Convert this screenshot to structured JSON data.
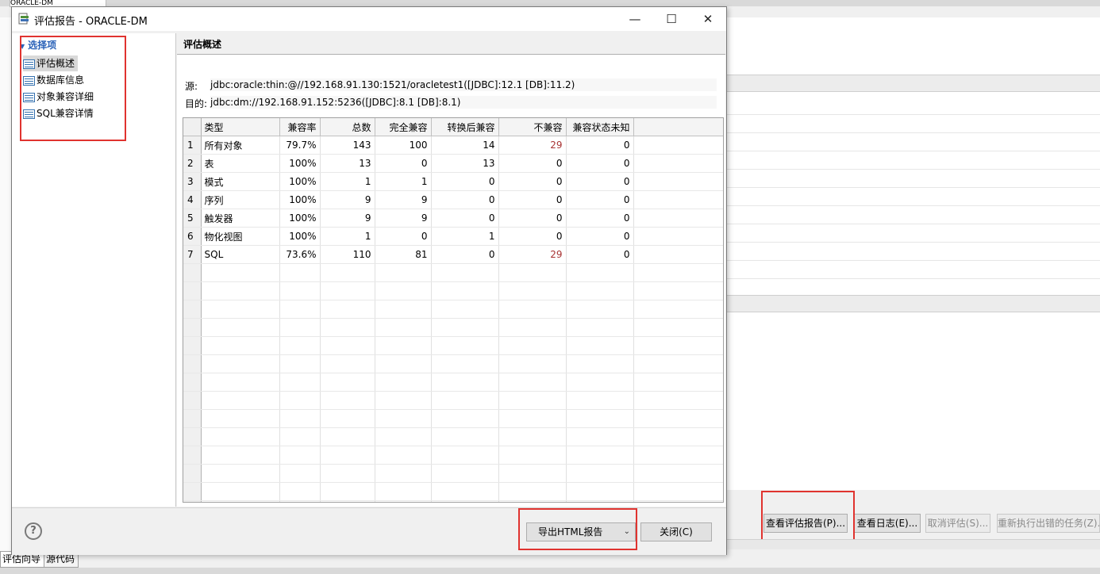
{
  "dialog": {
    "title": "评估报告 - ORACLE-DM",
    "controls": {
      "minimize": "—",
      "maximize": "☐",
      "close": "✕"
    }
  },
  "tree": {
    "root_label": "选择项",
    "items": [
      {
        "label": "评估概述",
        "selected": true
      },
      {
        "label": "数据库信息"
      },
      {
        "label": "对象兼容详细"
      },
      {
        "label": "SQL兼容详情"
      }
    ]
  },
  "overview": {
    "title": "评估概述",
    "source_label": "源:",
    "source_value": "jdbc:oracle:thin:@//192.168.91.130:1521/oracletest1([JDBC]:12.1 [DB]:11.2)",
    "target_label": "目的:",
    "target_value": "jdbc:dm://192.168.91.152:5236([JDBC]:8.1 [DB]:8.1)"
  },
  "table": {
    "headers": [
      "类型",
      "兼容率",
      "总数",
      "完全兼容",
      "转换后兼容",
      "不兼容",
      "兼容状态未知"
    ],
    "rows": [
      [
        "1",
        "所有对象",
        "79.7%",
        "143",
        "100",
        "14",
        "29",
        "0"
      ],
      [
        "2",
        "表",
        "100%",
        "13",
        "0",
        "13",
        "0",
        "0"
      ],
      [
        "3",
        "模式",
        "100%",
        "1",
        "1",
        "0",
        "0",
        "0"
      ],
      [
        "4",
        "序列",
        "100%",
        "9",
        "9",
        "0",
        "0",
        "0"
      ],
      [
        "5",
        "触发器",
        "100%",
        "9",
        "9",
        "0",
        "0",
        "0"
      ],
      [
        "6",
        "物化视图",
        "100%",
        "1",
        "0",
        "1",
        "0",
        "0"
      ],
      [
        "7",
        "SQL",
        "73.6%",
        "110",
        "81",
        "0",
        "29",
        "0"
      ]
    ]
  },
  "footer": {
    "help": "?",
    "export_label": "导出HTML报告",
    "close_label": "关闭(C)"
  },
  "background": {
    "tab_title": "ORACLE-DM",
    "buttons": [
      "查看评估报告(P)...",
      "查看日志(E)...",
      "取消评估(S)...",
      "重新执行出错的任务(Z)..."
    ],
    "bottom_tabs": [
      "评估向导",
      "源代码"
    ]
  },
  "colors": {
    "highlight_box": "#e0332f",
    "incompatible_text": "#a83232",
    "tree_root": "#2a62b8"
  }
}
